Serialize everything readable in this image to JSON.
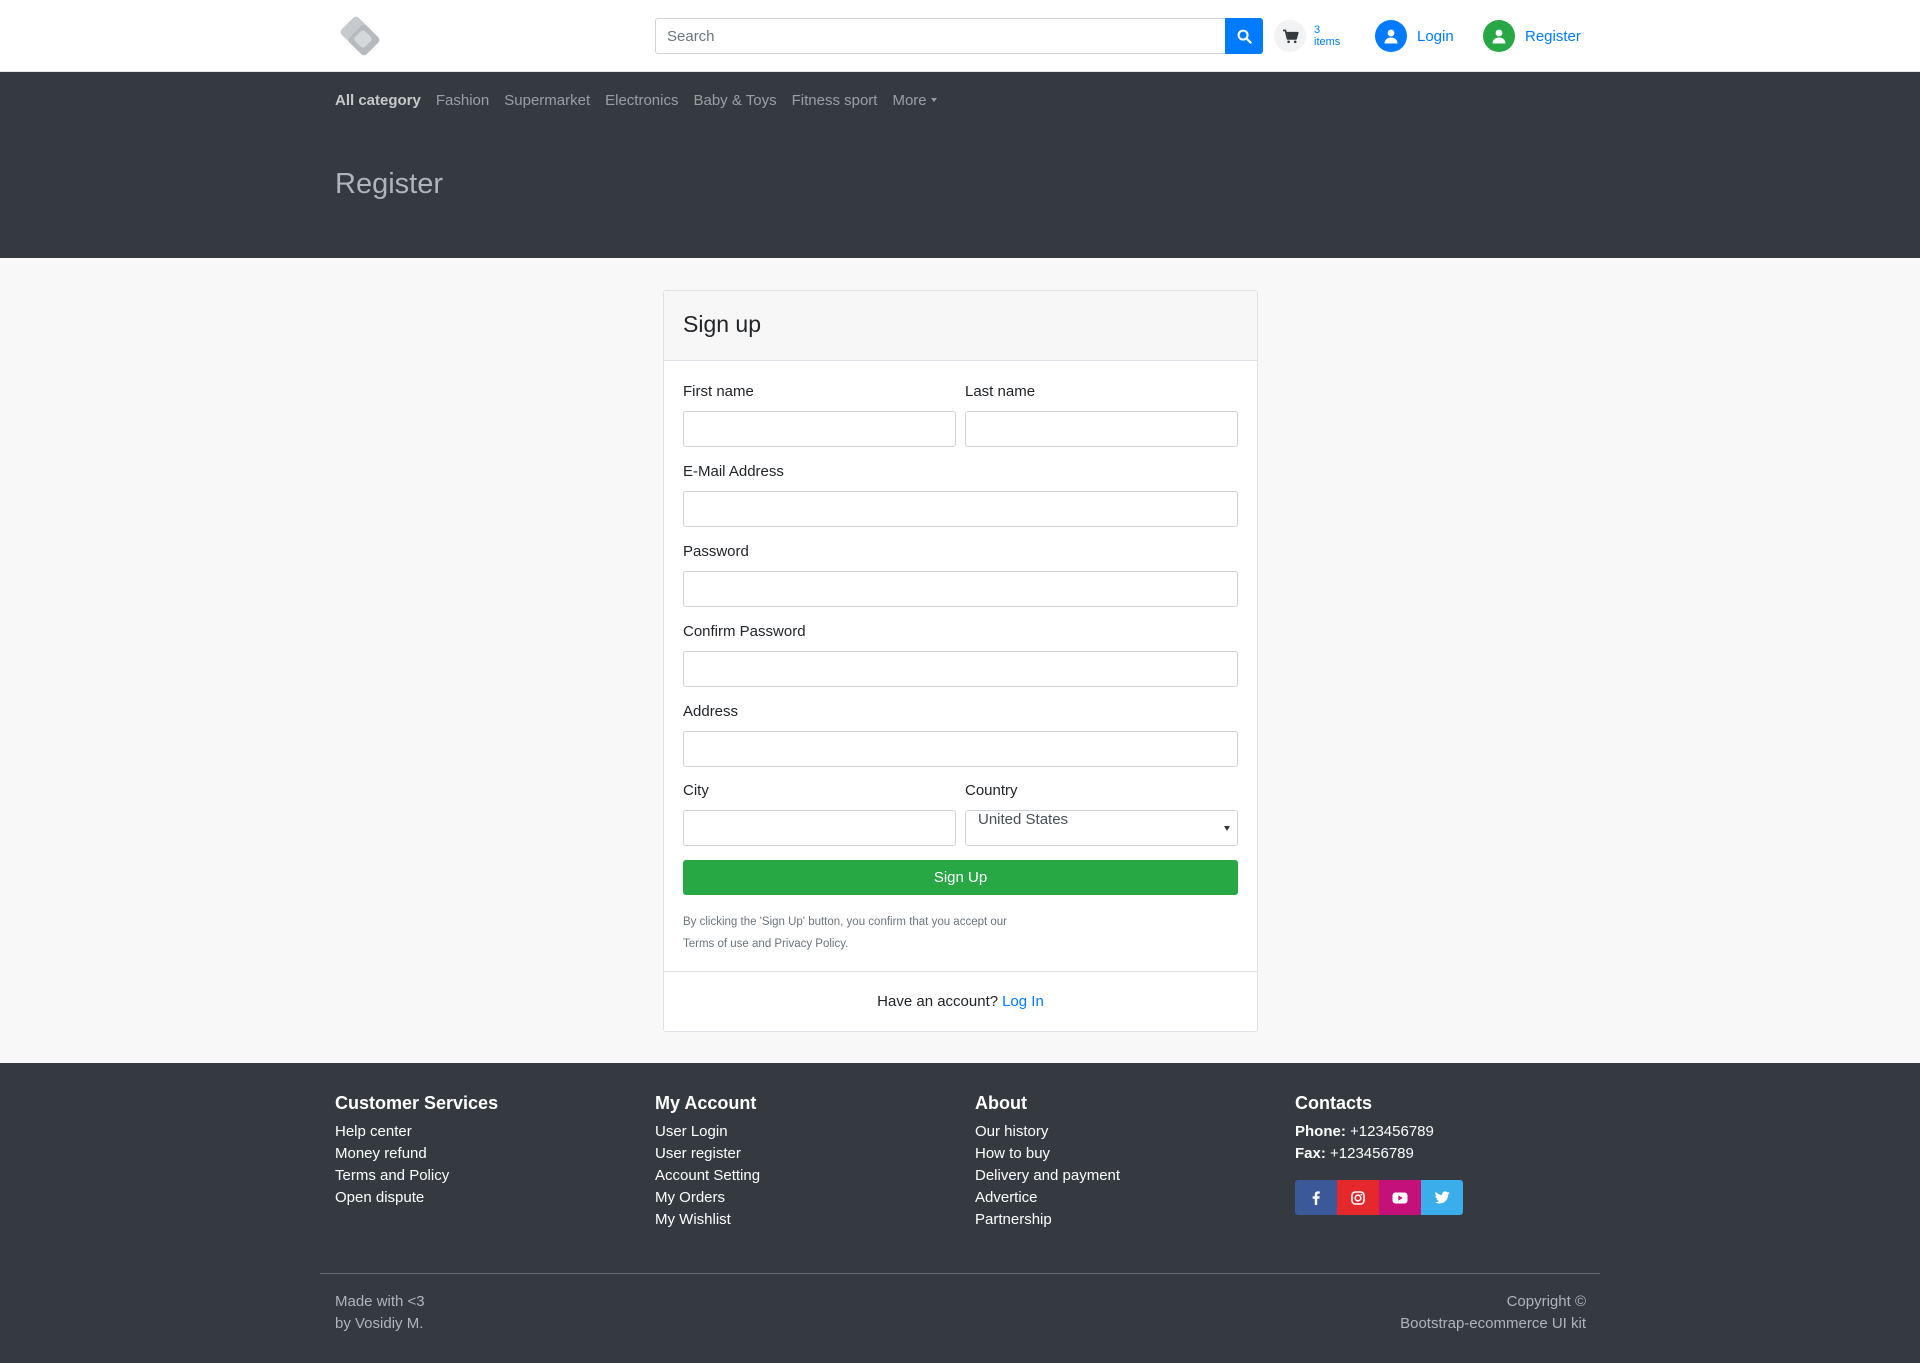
{
  "header": {
    "logo_icon": "brand-logo-icon",
    "search": {
      "placeholder": "Search",
      "value": ""
    },
    "cart": {
      "count_line1": "3",
      "count_line2": "items"
    },
    "login_label": "Login",
    "register_label": "Register"
  },
  "nav": {
    "categories": [
      "All category",
      "Fashion",
      "Supermarket",
      "Electronics",
      "Baby & Toys",
      "Fitness sport"
    ],
    "more_label": "More"
  },
  "page_title": "Register",
  "form": {
    "heading": "Sign up",
    "first_name_label": "First name",
    "last_name_label": "Last name",
    "email_label": "E-Mail Address",
    "password_label": "Password",
    "confirm_password_label": "Confirm Password",
    "address_label": "Address",
    "city_label": "City",
    "country_label": "Country",
    "country_value": "United States",
    "submit_label": "Sign Up",
    "terms_line1": "By clicking the 'Sign Up' button, you confirm that you accept our",
    "terms_link": "Terms of use",
    "terms_and": " and ",
    "privacy_link": "Privacy Policy",
    "terms_end": ".",
    "footer_text": "Have an account?",
    "footer_link": "Log In"
  },
  "footer": {
    "customer_services": {
      "title": "Customer Services",
      "items": [
        "Help center",
        "Money refund",
        "Terms and Policy",
        "Open dispute"
      ]
    },
    "my_account": {
      "title": "My Account",
      "items": [
        "User Login",
        "User register",
        "Account Setting",
        "My Orders",
        "My Wishlist"
      ]
    },
    "about": {
      "title": "About",
      "items": [
        "Our history",
        "How to buy",
        "Delivery and payment",
        "Advertice",
        "Partnership"
      ]
    },
    "contacts": {
      "title": "Contacts",
      "phone_label": "Phone:",
      "phone_value": "+123456789",
      "fax_label": "Fax:",
      "fax_value": "+123456789",
      "socials": [
        "facebook-icon",
        "instagram-icon",
        "youtube-icon",
        "twitter-icon"
      ]
    },
    "made_with": "Made with <3",
    "made_by": "by Vosidiy M.",
    "copyright": "Copyright ©",
    "copyright_sub": "Bootstrap-ecommerce UI kit"
  },
  "colors": {
    "primary": "#007bff",
    "success": "#28a745",
    "dark": "#343a40",
    "facebook": "#3b5998",
    "instagram": "#e4282c",
    "youtube": "#c4117a",
    "twitter": "#3aaeea"
  }
}
